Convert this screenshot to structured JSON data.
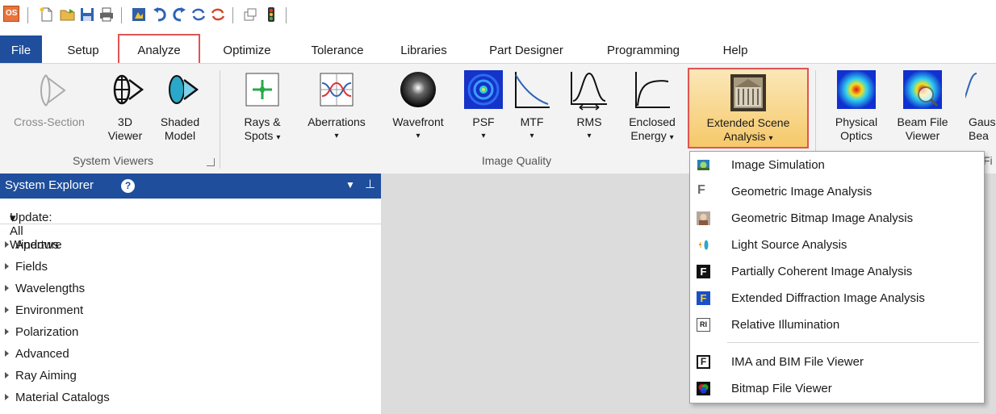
{
  "app": {
    "logo_text": "OS"
  },
  "menu": {
    "tabs": [
      "File",
      "Setup",
      "Analyze",
      "Optimize",
      "Tolerance",
      "Libraries",
      "Part Designer",
      "Programming",
      "Help"
    ],
    "active": "Analyze"
  },
  "ribbon": {
    "system_viewers": {
      "cross_section": "Cross-Section",
      "viewer3d_line1": "3D",
      "viewer3d_line2": "Viewer",
      "shaded_line1": "Shaded",
      "shaded_line2": "Model",
      "group_label": "System Viewers"
    },
    "image_quality": {
      "rays_line1": "Rays &",
      "rays_line2": "Spots",
      "aberrations": "Aberrations",
      "wavefront": "Wavefront",
      "psf": "PSF",
      "mtf": "MTF",
      "rms": "RMS",
      "enclosed_line1": "Enclosed",
      "enclosed_line2": "Energy",
      "extended_line1": "Extended Scene",
      "extended_line2": "Analysis",
      "group_label": "Image Quality"
    },
    "physical_optics": {
      "physical_line1": "Physical",
      "physical_line2": "Optics",
      "beam_line1": "Beam File",
      "beam_line2": "Viewer",
      "gauss_line1": "Gaus",
      "gauss_line2": "Bea",
      "group_partial": "Fi"
    },
    "caret": "▾"
  },
  "explorer": {
    "title": "System Explorer",
    "help": "?",
    "update_label": "Update: All Windows",
    "items": [
      "Aperture",
      "Fields",
      "Wavelengths",
      "Environment",
      "Polarization",
      "Advanced",
      "Ray Aiming",
      "Material Catalogs"
    ]
  },
  "dropdown": {
    "items": [
      "Image Simulation",
      "Geometric Image Analysis",
      "Geometric Bitmap Image Analysis",
      "Light Source Analysis",
      "Partially Coherent Image Analysis",
      "Extended Diffraction Image Analysis",
      "Relative Illumination",
      "IMA and BIM File Viewer",
      "Bitmap File Viewer"
    ],
    "icon_letter_f": "F",
    "icon_letter_ri": "RI"
  }
}
